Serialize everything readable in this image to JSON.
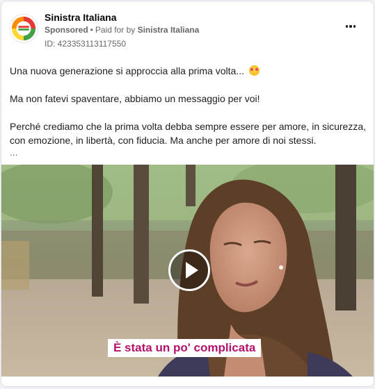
{
  "post": {
    "page_name": "Sinistra Italiana",
    "sponsored_label": "Sponsored",
    "paid_for_prefix": "Paid for by",
    "payer_name": "Sinistra Italiana",
    "ad_id": "ID: 423353113117550",
    "more_icon": "more-horizontal-icon",
    "avatar_icon": "page-logo"
  },
  "text": {
    "line1": "Una nuova generazione si approccia alla prima volta...",
    "line1_emoji": "smiling-face-with-heart-eyes",
    "line2": "Ma non fatevi spaventare, abbiamo un messaggio per voi!",
    "line3": "Perché crediamo che la prima volta debba sempre essere per amore, in sicurezza, con emozione, in libertà, con fiducia. Ma anche per amore di noi stessi.",
    "see_more": "..."
  },
  "video": {
    "subtitle": "È stata un po' complicata",
    "play_icon": "play-icon",
    "subtitle_color": "#b5126b"
  },
  "colors": {
    "accent": "#b5126b",
    "muted_text": "#65676b",
    "card_border": "#dadde1"
  }
}
